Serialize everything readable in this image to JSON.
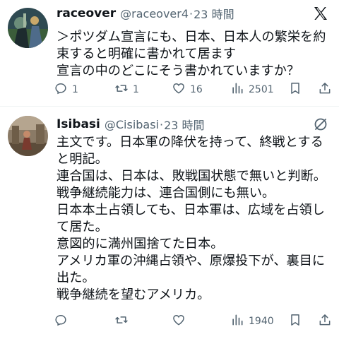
{
  "tweets": [
    {
      "name": "raceover",
      "handle": "@raceover4",
      "separator": "·",
      "time": "23 時間",
      "body": [
        "＞ポツダム宣言にも、日本、日本人の繁栄を約",
        "束すると明確に書かれて居ます",
        "宣言の中のどこにそう書かれていますか？"
      ],
      "reply_count": "1",
      "retweet_count": "1",
      "like_count": "16",
      "view_count": "2501",
      "header_icon": "x-logo-icon"
    },
    {
      "name": "Isibasi",
      "handle": "@Cisibasi",
      "separator": "·",
      "time": "23 時間",
      "body": [
        "主文です。日本軍の降伏を持って、終戦とする",
        "と明記。",
        "連合国は、日本は、敗戦国状態で無いと判断。",
        "戦争継続能力は、連合国側にも無い。",
        "日本本土占領しても、日本軍は、広域を占領し",
        "て居た。",
        "意図的に満州国捨てた日本。",
        "アメリカ軍の沖縄占領や、原爆投下が、裏目に",
        "出た。",
        "戦争継続を望むアメリカ。"
      ],
      "reply_count": "",
      "retweet_count": "",
      "like_count": "",
      "view_count": "1940",
      "header_icon": "grok-icon"
    }
  ],
  "colors": {
    "text": "#0f1419",
    "secondary": "#536471",
    "divider": "#eff3f4"
  }
}
